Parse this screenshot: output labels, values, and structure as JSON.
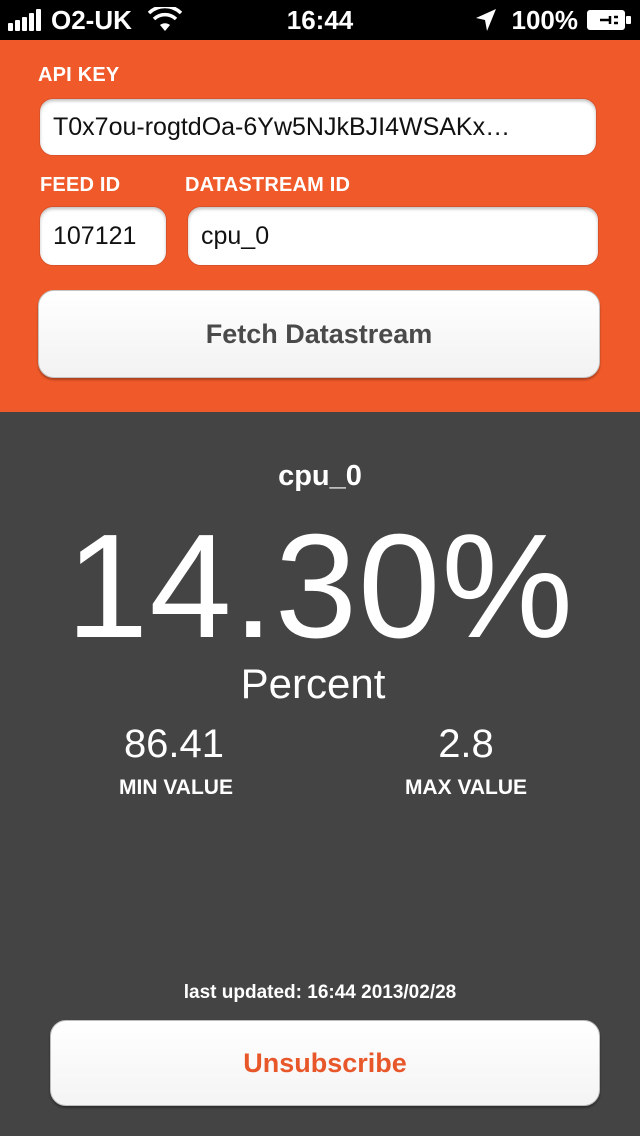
{
  "status_bar": {
    "carrier": "O2-UK",
    "time": "16:44",
    "battery_percent": "100%",
    "icons": [
      "signal-icon",
      "wifi-icon",
      "location-icon",
      "battery-icon"
    ]
  },
  "config": {
    "api_key_label": "API KEY",
    "api_key_value": "T0x7ou-rogtdOa-6Yw5NJkBJI4WSAKx…",
    "feed_id_label": "FEED ID",
    "feed_id_value": "107121",
    "datastream_id_label": "DATASTREAM ID",
    "datastream_id_value": "cpu_0",
    "fetch_button_label": "Fetch Datastream"
  },
  "datastream": {
    "name": "cpu_0",
    "current_value": "14.30%",
    "unit": "Percent",
    "min_value": "86.41",
    "min_label": "MIN VALUE",
    "max_value": "2.8",
    "max_label": "MAX VALUE",
    "last_updated": "last updated: 16:44 2013/02/28",
    "unsubscribe_label": "Unsubscribe"
  },
  "colors": {
    "accent": "#f05a2a",
    "background": "#444444",
    "status_bar": "#000000"
  }
}
